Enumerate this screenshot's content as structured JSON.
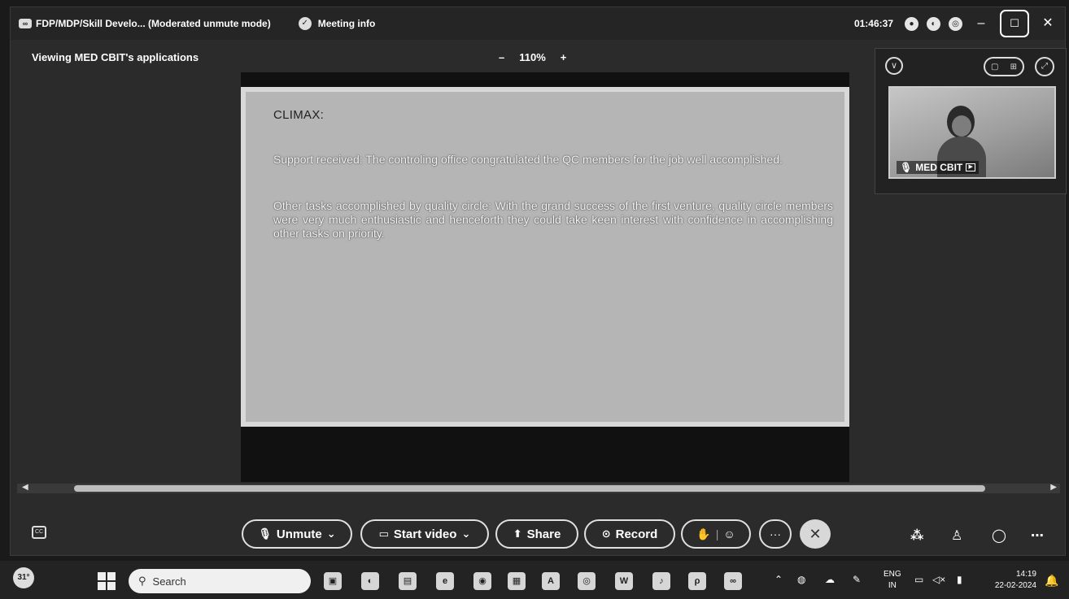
{
  "titlebar": {
    "meeting_title": "FDP/MDP/Skill Develo... (Moderated unmute mode)",
    "meeting_info": "Meeting info",
    "timer": "01:46:37"
  },
  "viewer": {
    "viewing_label": "Viewing MED CBIT's applications",
    "zoom_minus": "–",
    "zoom_level": "110%",
    "zoom_plus": "+"
  },
  "slide": {
    "title": "CLIMAX:",
    "paragraph1": "Support received: The controling office congratulated the QC members for the job well accomplished.",
    "paragraph2": "Other tasks accomplished by quality circle: With the grand success of the first venture, quality circle members were very much enthusiastic and henceforth they could take keen interest with confidence in accomplishing other tasks on priority."
  },
  "video": {
    "participant_name": "MED CBIT"
  },
  "controls": {
    "unmute": "Unmute",
    "start_video": "Start video",
    "share": "Share",
    "record": "Record",
    "more": "···"
  },
  "taskbar": {
    "weather": "31°",
    "search_placeholder": "Search",
    "lang_top": "ENG",
    "lang_bottom": "IN",
    "time": "14:19",
    "date": "22-02-2024"
  }
}
